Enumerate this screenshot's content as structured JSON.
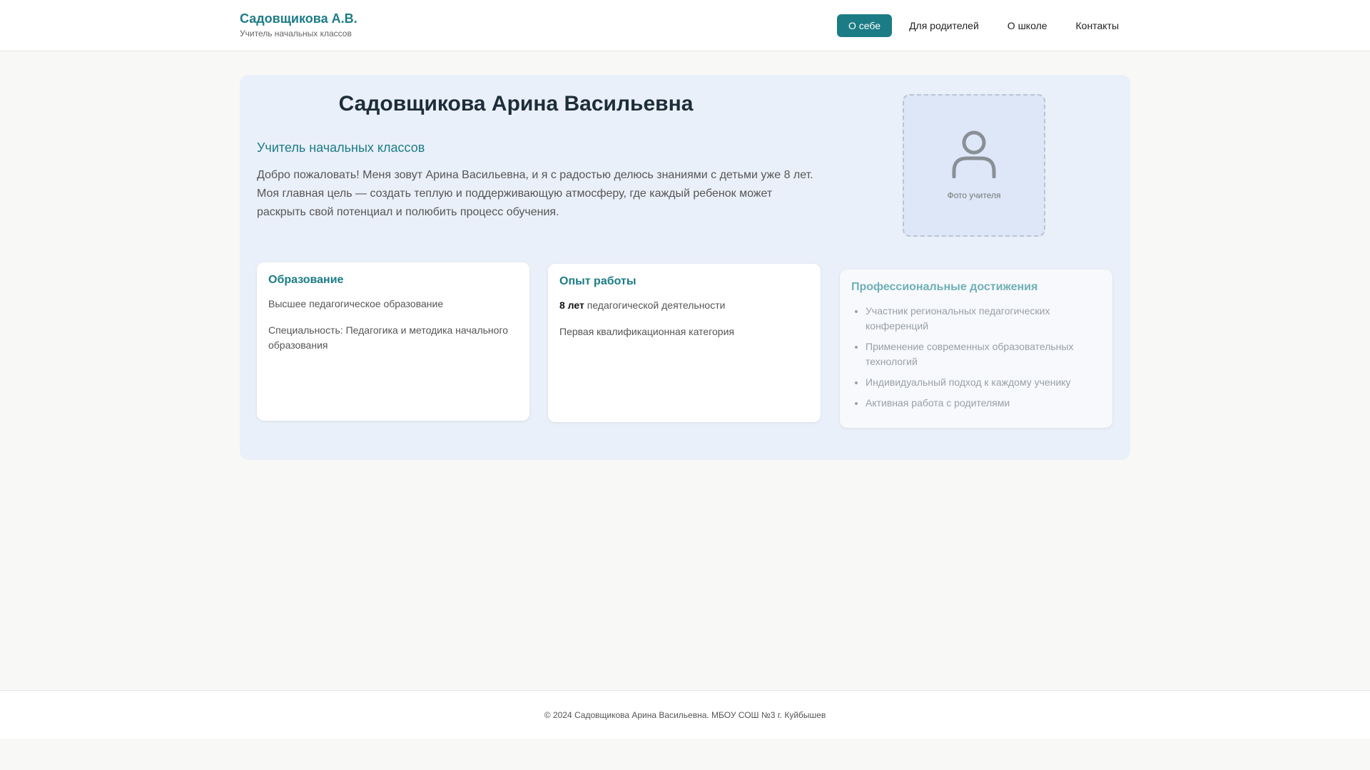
{
  "header": {
    "brand_name": "Садовщикова А.В.",
    "brand_subtitle": "Учитель начальных классов",
    "nav": [
      {
        "label": "О себе",
        "active": true
      },
      {
        "label": "Для родителей",
        "active": false
      },
      {
        "label": "О школе",
        "active": false
      },
      {
        "label": "Контакты",
        "active": false
      }
    ]
  },
  "profile": {
    "full_name": "Садовщикова Арина Васильевна",
    "position": "Учитель начальных классов",
    "intro": "Добро пожаловать! Меня зовут Арина Васильевна, и я с радостью делюсь знаниями с детьми уже 8 лет. Моя главная цель — создать теплую и поддерживающую атмосферу, где каждый ребенок может раскрыть свой потенциал и полюбить процесс обучения.",
    "photo_caption": "Фото учителя",
    "photo_icon": "user-icon"
  },
  "education": {
    "title": "Образование",
    "line1": "Высшее педагогическое образование",
    "line2": "Специальность: Педагогика и методика начального образования"
  },
  "experience": {
    "title": "Опыт работы",
    "years_bold": "8 лет",
    "years_rest": " педагогической деятельности",
    "category": "Первая квалификационная категория"
  },
  "achievements": {
    "title": "Профессиональные достижения",
    "items": [
      "Участник региональных педагогических конференций",
      "Применение современных образовательных технологий",
      "Индивидуальный подход к каждому ученику",
      "Активная работа с родителями"
    ]
  },
  "footer": {
    "text": "© 2024 Садовщикова Арина Васильевна. МБОУ СОШ №3 г. Куйбышев"
  },
  "colors": {
    "accent": "#1c7c86",
    "panel_bg": "#eaf0f9",
    "page_bg": "#f8f8f6"
  }
}
